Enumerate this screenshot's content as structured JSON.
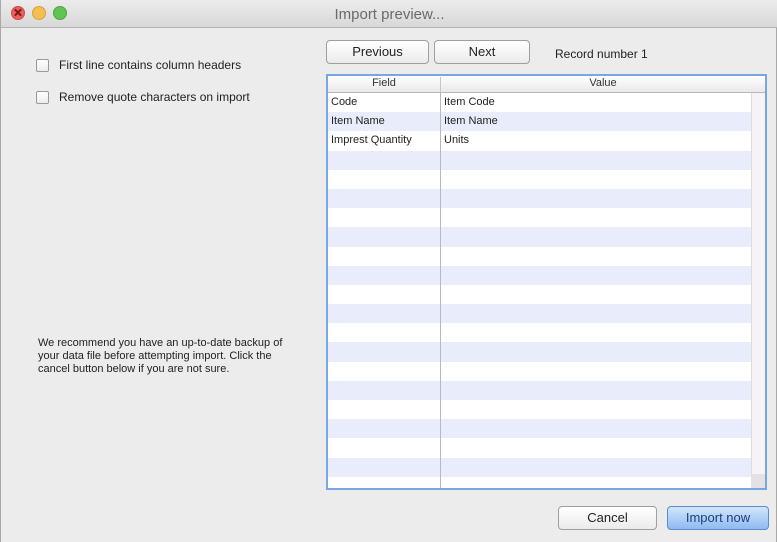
{
  "window": {
    "title": "Import preview..."
  },
  "options": {
    "first_line_headers": "First line contains column headers",
    "remove_quotes": "Remove quote characters on import"
  },
  "warning": "We recommend you have an up-to-date backup of your data file before attempting import. Click the cancel button below if you are not sure.",
  "nav": {
    "previous_label": "Previous",
    "next_label": "Next",
    "record_label": "Record number 1"
  },
  "table": {
    "headers": {
      "field": "Field",
      "value": "Value"
    },
    "rows": [
      {
        "field": "Code",
        "value": "Item Code"
      },
      {
        "field": "Item Name",
        "value": "Item Name"
      },
      {
        "field": "Imprest Quantity",
        "value": "Units"
      }
    ],
    "empty_row_count": 18
  },
  "actions": {
    "cancel_label": "Cancel",
    "import_label": "Import now"
  },
  "colors": {
    "accent": "#79a5e3",
    "row_alt": "#e8ecfb"
  }
}
